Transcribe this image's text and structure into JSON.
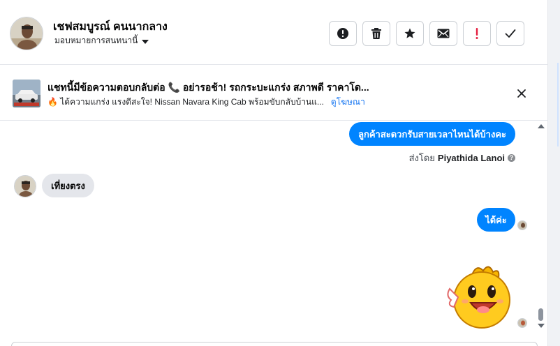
{
  "header": {
    "contact_name": "เชฟสมบูรณ์ คนนากลาง",
    "assign_label": "มอบหมายการสนทนานี้",
    "actions": [
      {
        "name": "mark-spam-button",
        "icon": "alert-circle-icon"
      },
      {
        "name": "delete-button",
        "icon": "trash-icon"
      },
      {
        "name": "star-button",
        "icon": "star-icon"
      },
      {
        "name": "mark-unread-button",
        "icon": "envelope-icon"
      },
      {
        "name": "follow-up-button",
        "icon": "exclamation-icon"
      },
      {
        "name": "mark-done-button",
        "icon": "check-icon"
      }
    ]
  },
  "ad": {
    "title": "แชทนี้มีข้อความตอบกลับต่อ 📞 อย่ารอช้า! รถกระบะแกร่ง สภาพดี ราคาโด...",
    "subtitle": "🔥 ได้ความแกร่ง แรงดีสะใจ! Nissan Navara King Cab พร้อมขับกลับบ้านแ...",
    "link": "ดูโฆษณา",
    "close_icon": "close-icon"
  },
  "messages": [
    {
      "direction": "out",
      "text": "ลูกค้าสะดวกรับสายเวลาไหนได้บ้างคะ"
    },
    {
      "type": "sent_by",
      "prefix": "ส่งโดย",
      "agent": "Piyathida Lanoi",
      "info": "?"
    },
    {
      "direction": "in",
      "text": "เที่ยงตรง"
    },
    {
      "direction": "out",
      "text": "ได้ค่ะ"
    },
    {
      "direction": "out",
      "type": "sticker",
      "sticker": "yellow-mascot-sticker"
    }
  ],
  "colors": {
    "accent": "#0084ff",
    "incoming_bubble": "#e4e6eb",
    "link": "#1877f2",
    "alert_red": "#e41e3f"
  }
}
